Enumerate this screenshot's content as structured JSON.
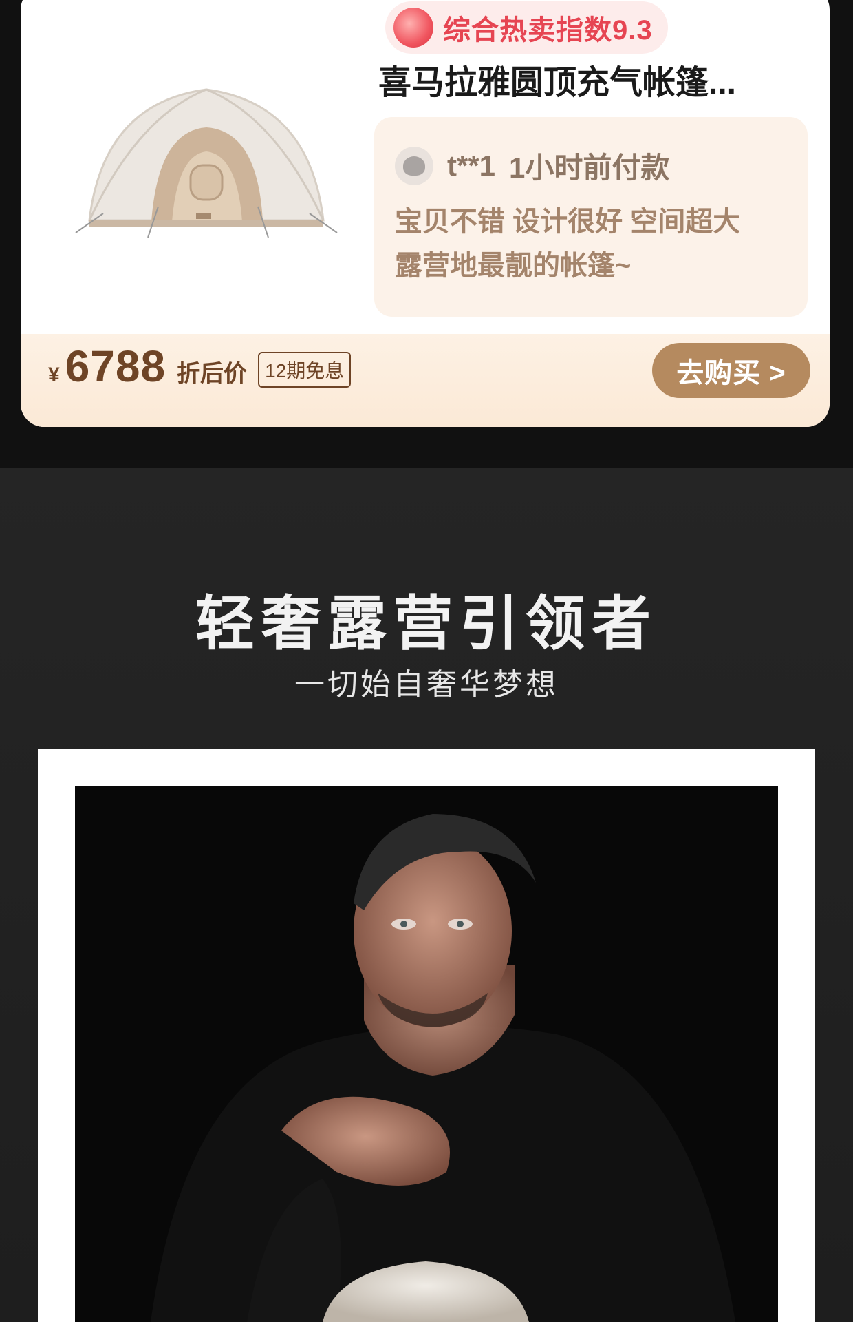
{
  "product": {
    "hot_index_label": "综合热卖指数9.3",
    "title": "喜马拉雅圆顶充气帐篷...",
    "review": {
      "user": "t**1",
      "time": "1小时前付款",
      "text": "宝贝不错 设计很好 空间超大\n露营地最靓的帐篷~"
    },
    "price": {
      "currency": "¥",
      "value": "6788",
      "label": "折后价",
      "installment": "12期免息"
    },
    "buy_button": "去购买 >"
  },
  "promo": {
    "title": "轻奢露营引领者",
    "subtitle": "一切始自奢华梦想"
  },
  "colors": {
    "accent_gold": "#b58a5f",
    "hot_red": "#e64552",
    "price_brown": "#6e4426"
  }
}
